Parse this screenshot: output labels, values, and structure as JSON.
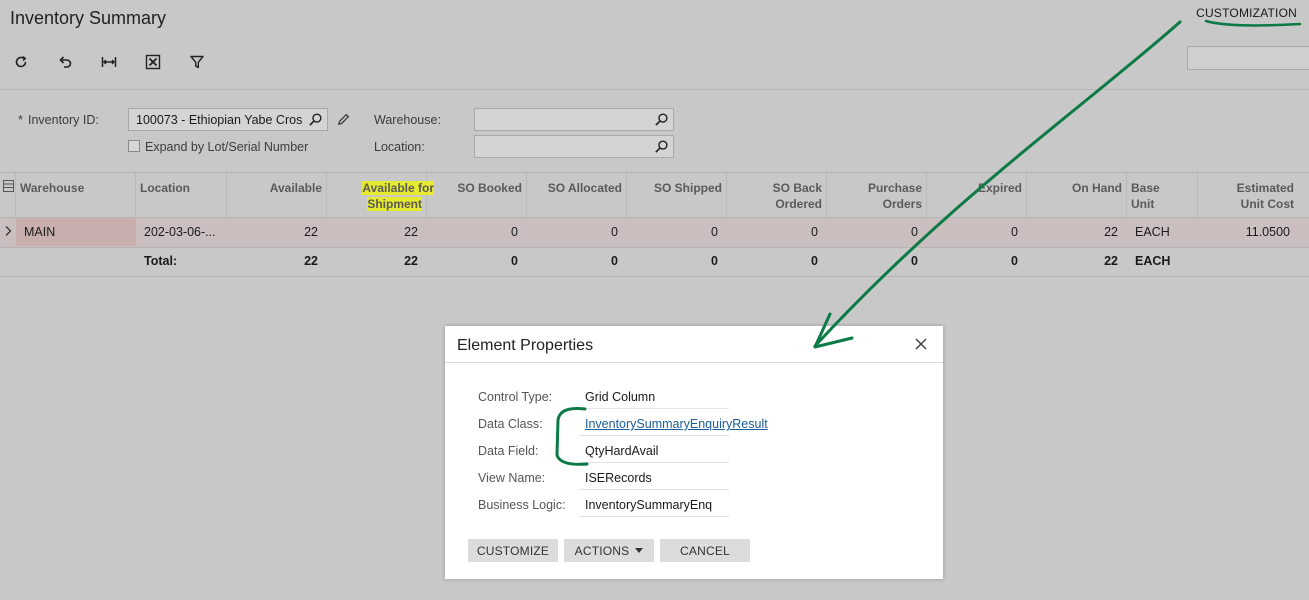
{
  "header": {
    "title": "Inventory Summary",
    "customization_label": "CUSTOMIZATION"
  },
  "toolbar": {
    "icons": [
      "refresh-icon",
      "undo-icon",
      "fit-to-width-icon",
      "export-excel-icon",
      "filter-icon"
    ]
  },
  "filters": {
    "inventory_id_label": "Inventory ID:",
    "inventory_id_value": "100073 - Ethiopian Yabe Cros",
    "warehouse_label": "Warehouse:",
    "warehouse_value": "",
    "location_label": "Location:",
    "location_value": "",
    "expand_label": "Expand by Lot/Serial Number",
    "expand_checked": false,
    "required_marker": "*"
  },
  "grid": {
    "columns": [
      "Warehouse",
      "Location",
      "Available",
      "Available for Shipment",
      "SO Booked",
      "SO Allocated",
      "SO Shipped",
      "SO Back Ordered",
      "Purchase Orders",
      "Expired",
      "On Hand",
      "Base Unit",
      "Estimated Unit Cost"
    ],
    "column_lines": {
      "available_for_shipment": [
        "Available for",
        "Shipment"
      ],
      "so_back_ordered": [
        "SO Back",
        "Ordered"
      ],
      "purchase_orders": [
        "Purchase",
        "Orders"
      ],
      "base_unit": [
        "Base",
        "Unit"
      ],
      "estimated_unit_cost": [
        "Estimated",
        "Unit Cost"
      ]
    },
    "rows": [
      {
        "warehouse": "MAIN",
        "location": "202-03-06-...",
        "available": "22",
        "available_for_shipment": "22",
        "so_booked": "0",
        "so_allocated": "0",
        "so_shipped": "0",
        "so_back_ordered": "0",
        "purchase_orders": "0",
        "expired": "0",
        "on_hand": "22",
        "base_unit": "EACH",
        "estimated_unit_cost": "11.0500"
      }
    ],
    "total": {
      "label": "Total:",
      "available": "22",
      "available_for_shipment": "22",
      "so_booked": "0",
      "so_allocated": "0",
      "so_shipped": "0",
      "so_back_ordered": "0",
      "purchase_orders": "0",
      "expired": "0",
      "on_hand": "22",
      "base_unit": "EACH"
    }
  },
  "dialog": {
    "title": "Element Properties",
    "fields": [
      {
        "label": "Control Type:",
        "value": "Grid Column"
      },
      {
        "label": "Data Class:",
        "value": "InventorySummaryEnquiryResult"
      },
      {
        "label": "Data Field:",
        "value": "QtyHardAvail"
      },
      {
        "label": "View Name:",
        "value": "ISERecords"
      },
      {
        "label": "Business Logic:",
        "value": "InventorySummaryEnq"
      }
    ],
    "buttons": {
      "customize": "CUSTOMIZE",
      "actions": "ACTIONS",
      "cancel": "CANCEL"
    }
  },
  "colors": {
    "highlight": "#e5ea2e",
    "annotation": "#0b7a45",
    "link": "#1a5d9a"
  }
}
